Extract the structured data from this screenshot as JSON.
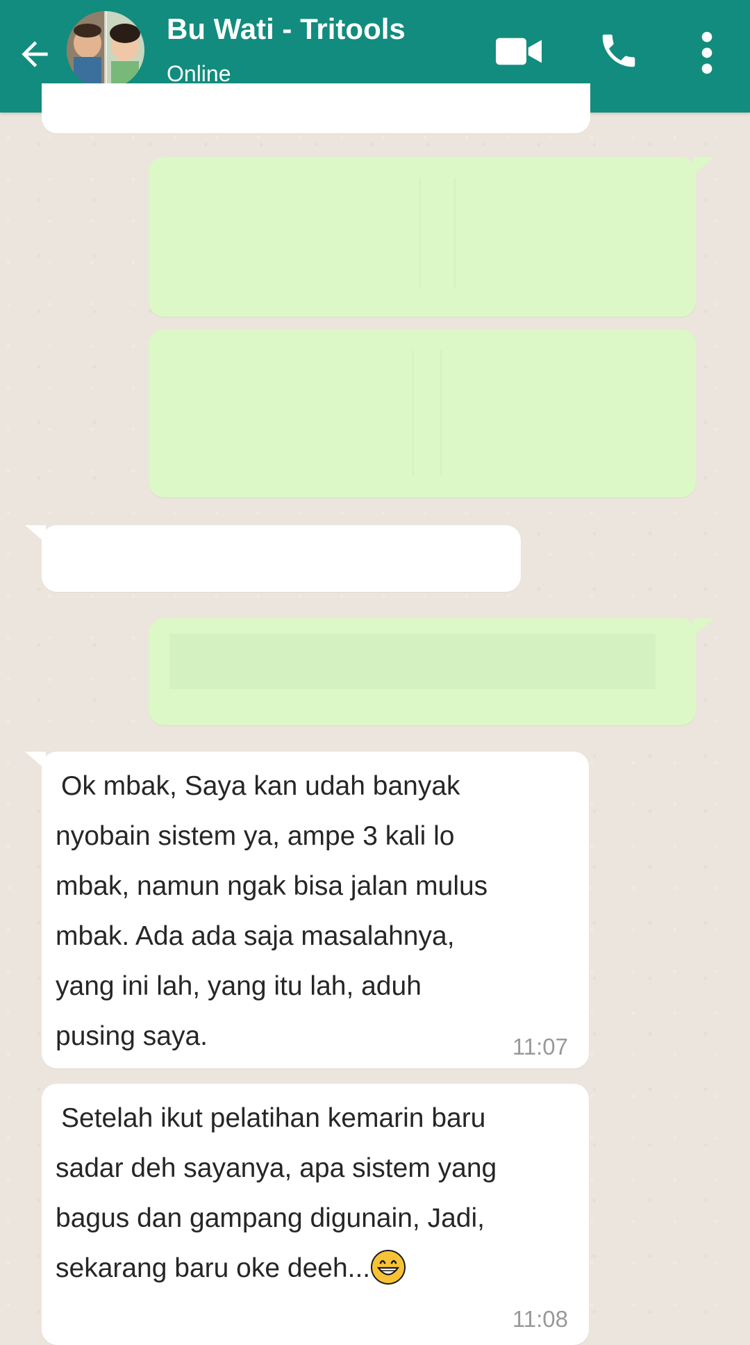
{
  "header": {
    "contact_name": "Bu Wati - Tritools",
    "status": "Online",
    "icons": [
      "back-arrow-icon",
      "avatar",
      "video-call-icon",
      "phone-call-icon",
      "more-options-icon"
    ],
    "color": "#128c7e"
  },
  "colors": {
    "incoming_bubble": "#ffffff",
    "outgoing_bubble": "#dcf8c6",
    "chat_background": "#ece5dd",
    "timestamp": "#999999"
  },
  "messages": [
    {
      "direction": "incoming",
      "lines": [
        "Ok mbak, Saya kan udah banyak",
        "nyobain sistem ya, ampe 3 kali lo",
        "mbak, namun ngak bisa jalan mulus",
        "mbak. Ada ada saja masalahnya,",
        "yang ini lah, yang itu lah, aduh",
        "pusing saya."
      ],
      "time": "11:07"
    },
    {
      "direction": "incoming",
      "lines": [
        "Setelah ikut pelatihan kemarin baru",
        "sadar deh sayanya, apa sistem yang",
        "bagus dan gampang digunain, Jadi,",
        "sekarang baru oke deeh..."
      ],
      "emoji": "grinning-face",
      "time": "11:08"
    }
  ]
}
